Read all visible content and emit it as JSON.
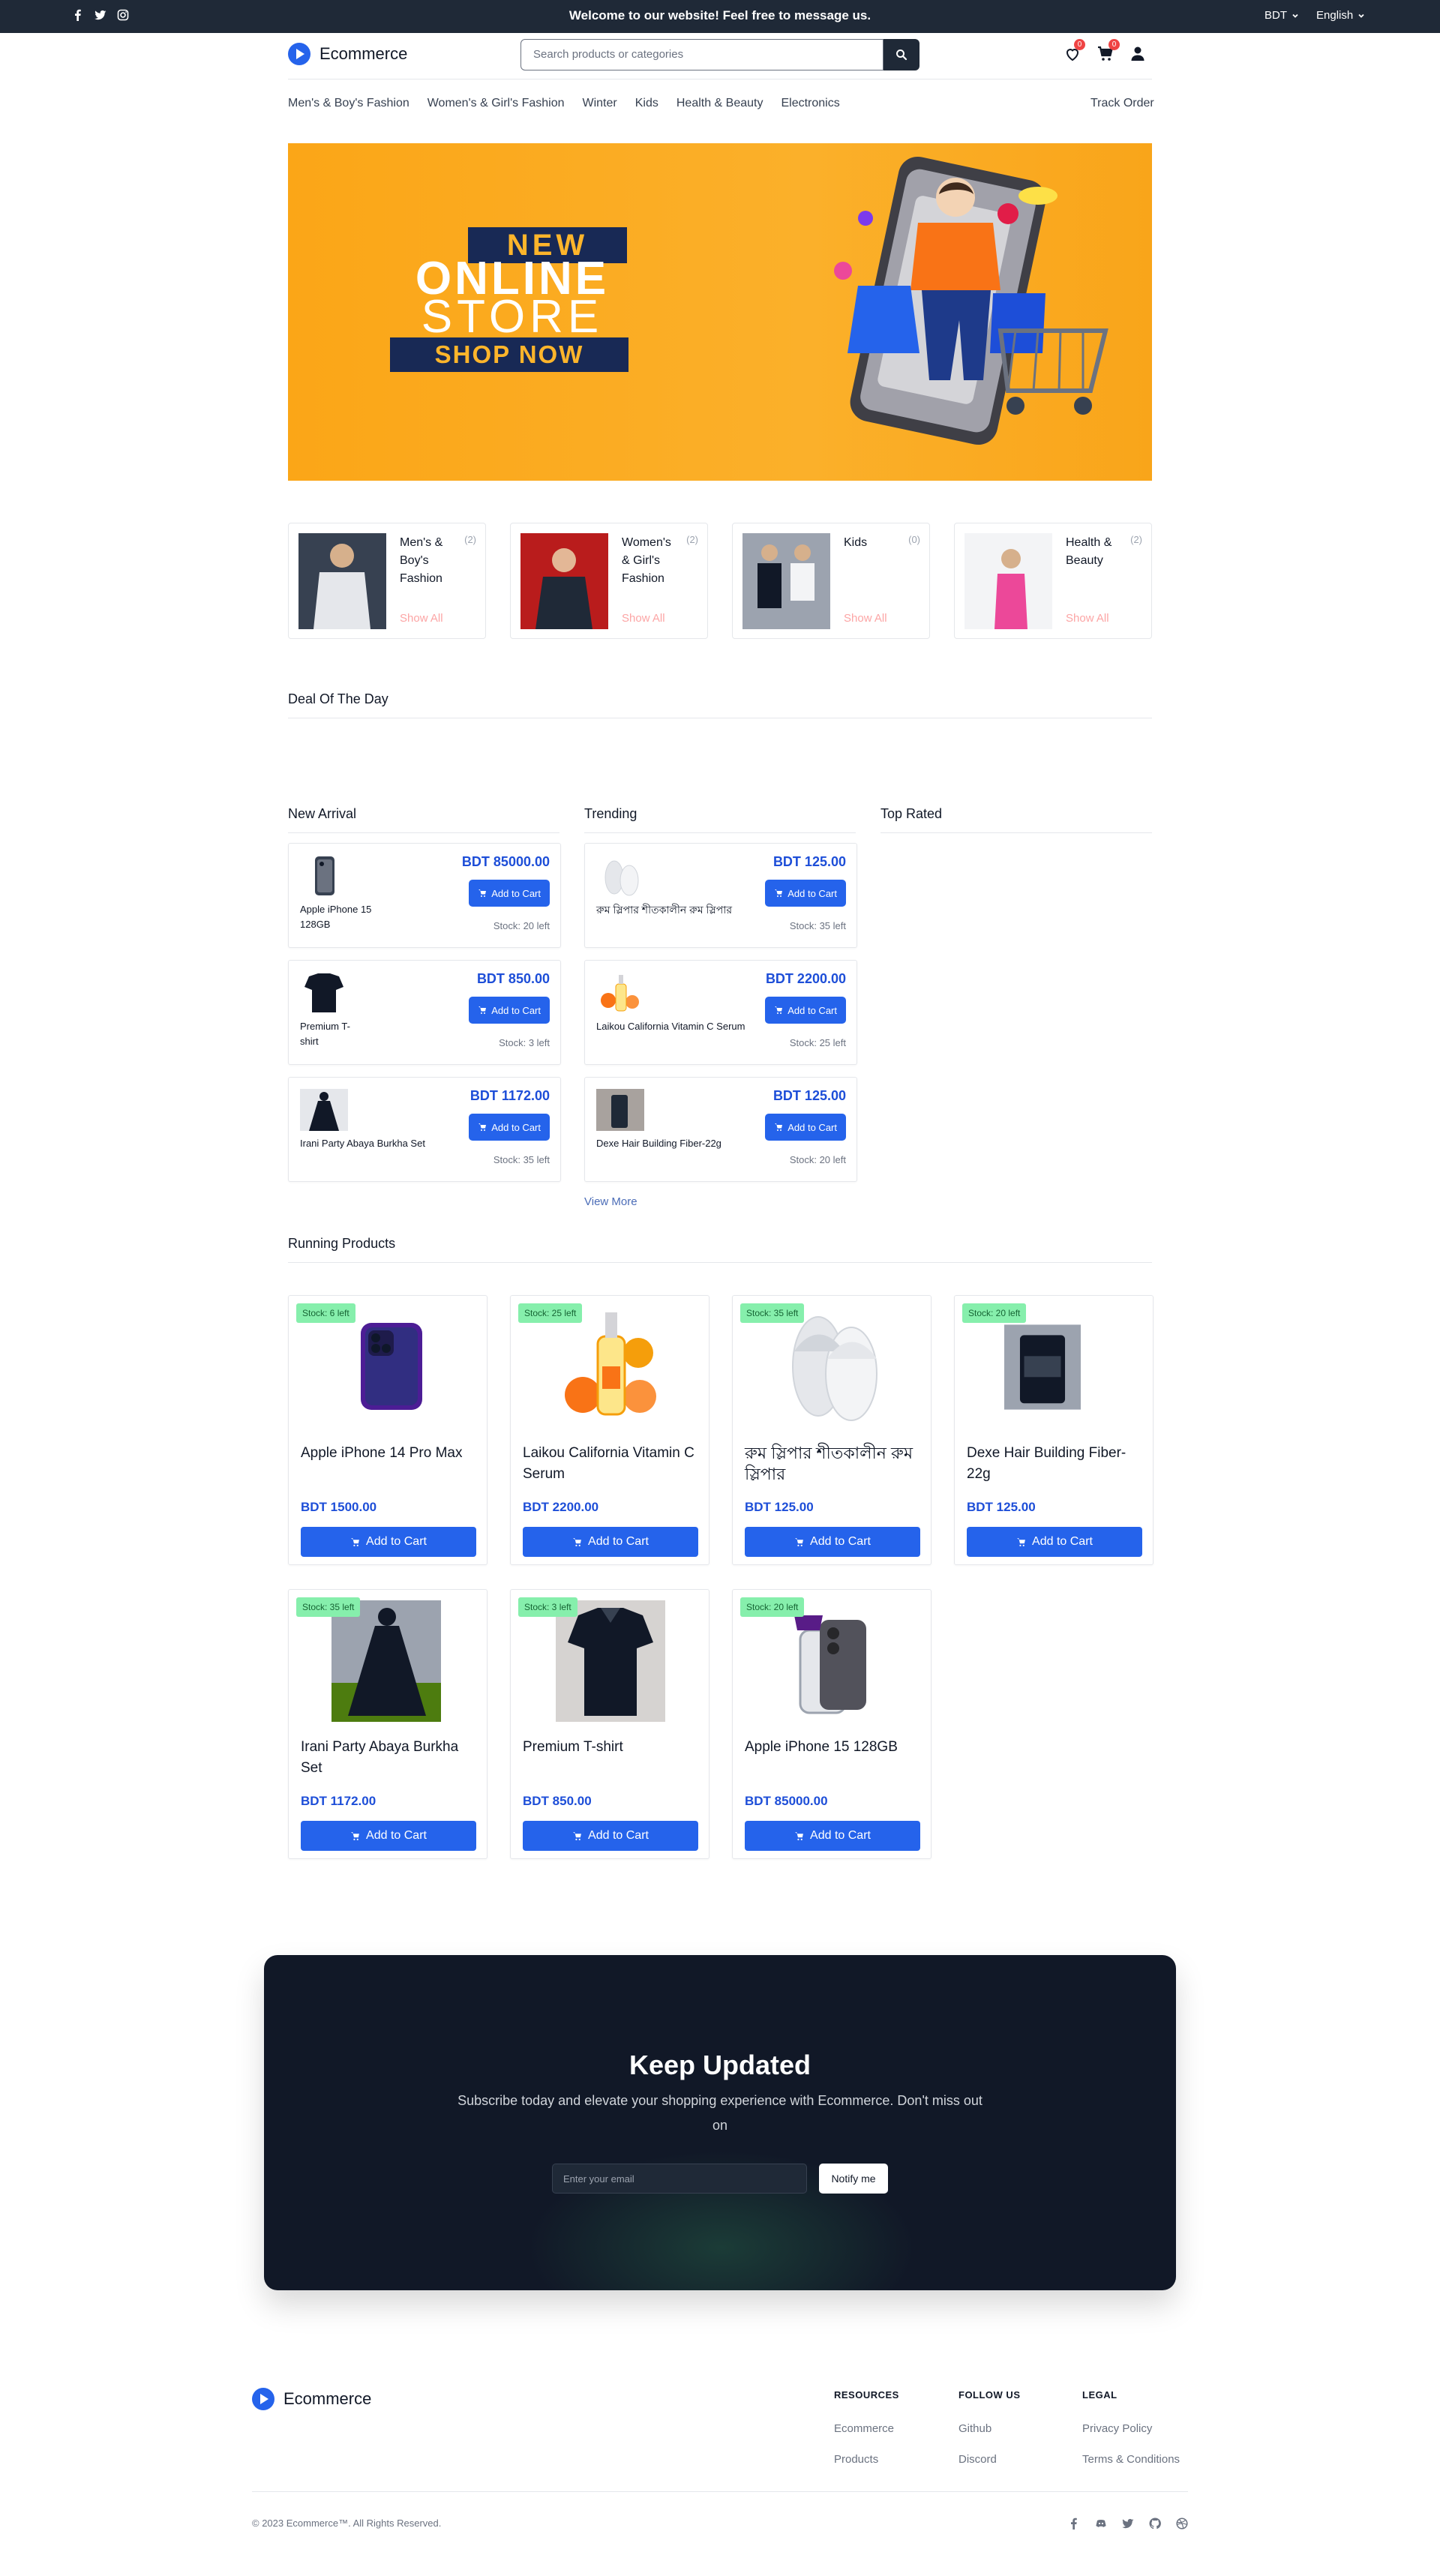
{
  "topbar": {
    "welcome": "Welcome to our website! Feel free to message us.",
    "currency": "BDT",
    "language": "English"
  },
  "header": {
    "brand": "Ecommerce",
    "search_placeholder": "Search products or categories",
    "wishlist_count": "0",
    "cart_count": "0"
  },
  "nav": {
    "items": [
      "Men's & Boy's Fashion",
      "Women's & Girl's Fashion",
      "Winter",
      "Kids",
      "Health & Beauty",
      "Electronics"
    ],
    "track_order": "Track Order"
  },
  "banner": {
    "line1": "NEW",
    "line2": "ONLINE",
    "line3": "STORE",
    "line4": "SHOP NOW"
  },
  "categories": [
    {
      "name": "Men's & Boy's Fashion",
      "count": "(2)",
      "show_all": "Show All"
    },
    {
      "name": "Women's & Girl's Fashion",
      "count": "(2)",
      "show_all": "Show All"
    },
    {
      "name": "Kids",
      "count": "(0)",
      "show_all": "Show All"
    },
    {
      "name": "Health & Beauty",
      "count": "(2)",
      "show_all": "Show All"
    }
  ],
  "sections": {
    "deal_of_day": "Deal Of The Day",
    "new_arrival": "New Arrival",
    "trending": "Trending",
    "top_rated": "Top Rated",
    "view_more": "View More",
    "running_products": "Running Products"
  },
  "add_to_cart": "Add to Cart",
  "new_arrival": [
    {
      "name": "Apple iPhone 15 128GB",
      "price": "BDT 85000.00",
      "stock": "Stock: 20 left",
      "icon": "phone-icon"
    },
    {
      "name": "Premium T-shirt",
      "price": "BDT 850.00",
      "stock": "Stock: 3 left",
      "icon": "shirt-icon"
    },
    {
      "name": "Irani Party Abaya Burkha Set",
      "price": "BDT 1172.00",
      "stock": "Stock: 35 left",
      "icon": "dress-icon"
    }
  ],
  "trending": [
    {
      "name": "রুম স্লিপার শীতকালীন রুম স্লিপার",
      "price": "BDT 125.00",
      "stock": "Stock: 35 left",
      "icon": "slipper-icon"
    },
    {
      "name": "Laikou California Vitamin C Serum",
      "price": "BDT 2200.00",
      "stock": "Stock: 25 left",
      "icon": "serum-icon"
    },
    {
      "name": "Dexe Hair Building Fiber-22g",
      "price": "BDT 125.00",
      "stock": "Stock: 20 left",
      "icon": "bottle-icon"
    }
  ],
  "running": [
    {
      "name": "Apple iPhone 14 Pro Max",
      "price": "BDT 1500.00",
      "stock": "Stock: 6 left",
      "icon": "phone-icon"
    },
    {
      "name": "Laikou California Vitamin C Serum",
      "price": "BDT 2200.00",
      "stock": "Stock: 25 left",
      "icon": "serum-icon"
    },
    {
      "name": "রুম স্লিপার শীতকালীন রুম স্লিপার",
      "price": "BDT 125.00",
      "stock": "Stock: 35 left",
      "icon": "slipper-icon"
    },
    {
      "name": "Dexe Hair Building Fiber-22g",
      "price": "BDT 125.00",
      "stock": "Stock: 20 left",
      "icon": "bottle-icon"
    },
    {
      "name": "Irani Party Abaya Burkha Set",
      "price": "BDT 1172.00",
      "stock": "Stock: 35 left",
      "icon": "dress-icon"
    },
    {
      "name": "Premium T-shirt",
      "price": "BDT 850.00",
      "stock": "Stock: 3 left",
      "icon": "shirt-icon"
    },
    {
      "name": "Apple iPhone 15 128GB",
      "price": "BDT 85000.00",
      "stock": "Stock: 20 left",
      "icon": "phone-icon"
    }
  ],
  "newsletter": {
    "title": "Keep Updated",
    "subtitle": "Subscribe today and elevate your shopping experience with Ecommerce. Don't miss out on",
    "email_placeholder": "Enter your email",
    "button": "Notify me"
  },
  "footer": {
    "brand": "Ecommerce",
    "resources_title": "RESOURCES",
    "resources": [
      "Ecommerce",
      "Products"
    ],
    "follow_title": "FOLLOW US",
    "follow": [
      "Github",
      "Discord"
    ],
    "legal_title": "LEGAL",
    "legal": [
      "Privacy Policy",
      "Terms & Conditions"
    ],
    "copyright": "© 2023 Ecommerce™. All Rights Reserved."
  },
  "colors": {
    "accent": "#2563eb",
    "dark": "#1f2937",
    "banner": "#fba617",
    "badge": "#86efac"
  }
}
